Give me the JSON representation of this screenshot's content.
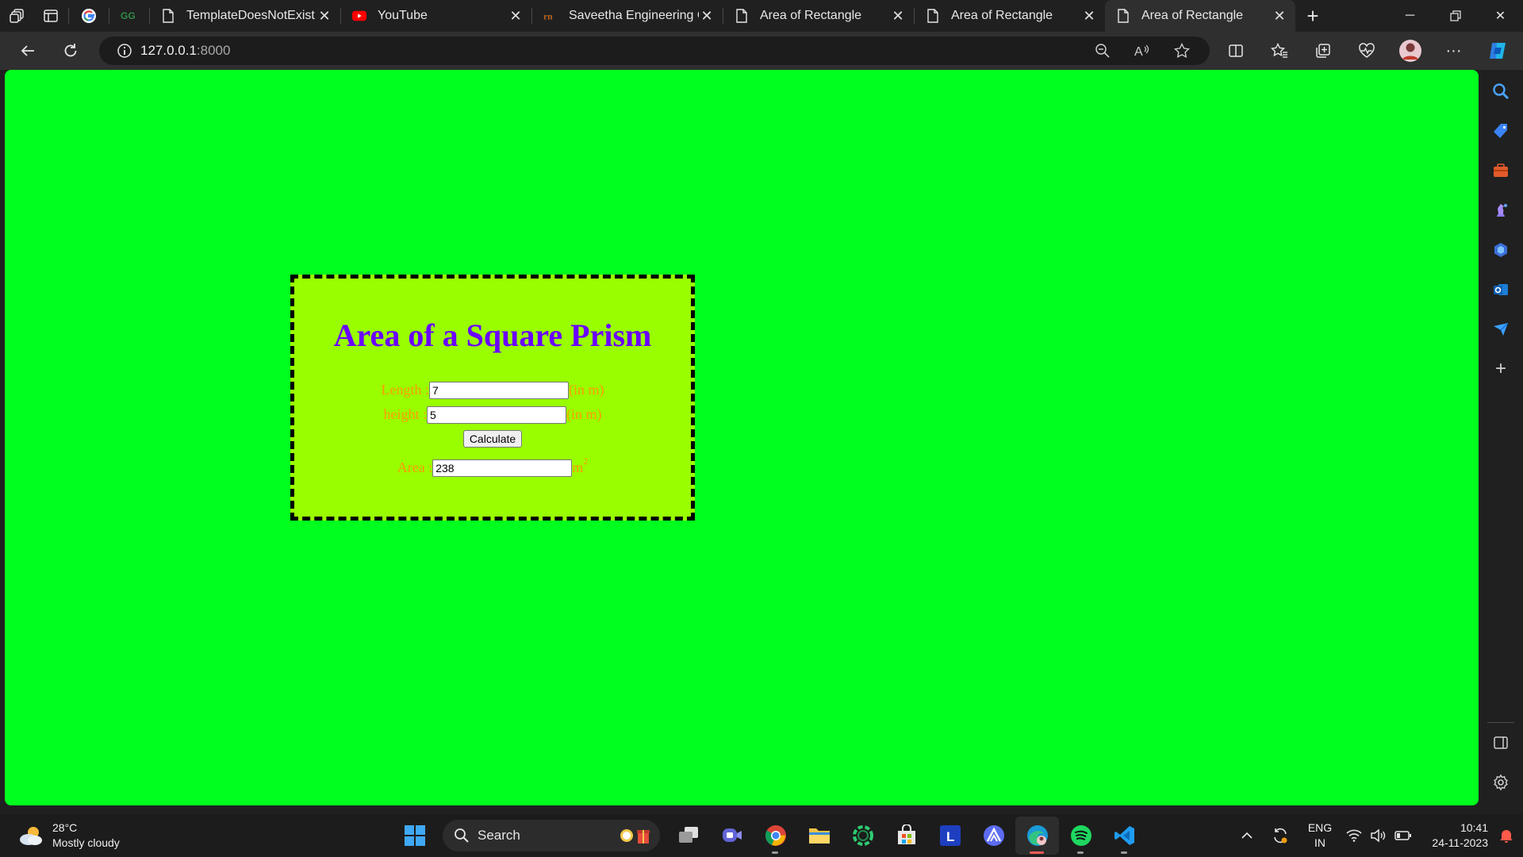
{
  "browser": {
    "tabs": [
      {
        "title": "TemplateDoesNotExist a",
        "icon": "page-icon"
      },
      {
        "title": "YouTube",
        "icon": "youtube-icon"
      },
      {
        "title": "Saveetha Engineering C",
        "icon": "saveetha-icon"
      },
      {
        "title": "Area of Rectangle",
        "icon": "page-icon"
      },
      {
        "title": "Area of Rectangle",
        "icon": "page-icon"
      },
      {
        "title": "Area of Rectangle",
        "icon": "page-icon",
        "active": true
      }
    ],
    "url_host": "127.0.0.1",
    "url_port": ":8000"
  },
  "page": {
    "heading": "Area of a Square Prism",
    "length_label": "Length : ",
    "length_value": "7",
    "length_unit": "(in m)",
    "height_label": "height : ",
    "height_value": "5",
    "height_unit": "(in m)",
    "calculate_label": "Calculate",
    "area_label": "Area : ",
    "area_value": "238",
    "area_unit": "m",
    "area_unit_power": "2"
  },
  "colors": {
    "page_bg": "#00ff1e",
    "card_bg": "#99ff00",
    "heading": "#6a00ff",
    "labels": "#ff9900"
  },
  "taskbar": {
    "weather_temp": "28°C",
    "weather_desc": "Mostly cloudy",
    "search_label": "Search",
    "lang_top": "ENG",
    "lang_bottom": "IN",
    "time": "10:41",
    "date": "24-11-2023"
  }
}
